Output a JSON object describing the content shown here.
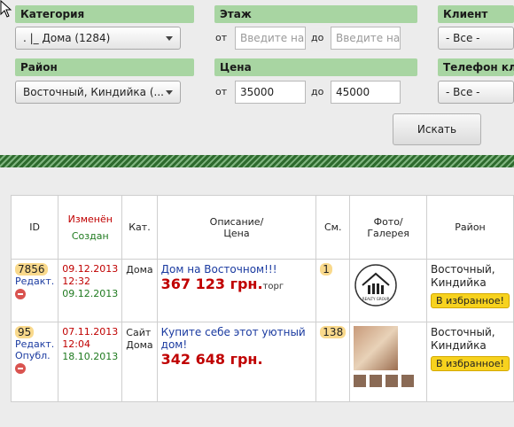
{
  "filters": {
    "category": {
      "label": "Категория",
      "value": ".       |_ Дома (1284)"
    },
    "floor": {
      "label": "Этаж",
      "from_label": "от",
      "from_placeholder": "Введите нач",
      "to_label": "до",
      "to_placeholder": "Введите нач"
    },
    "client": {
      "label": "Клиент",
      "value": "- Все -"
    },
    "district": {
      "label": "Район",
      "value": "Восточный, Киндийка (..."
    },
    "price": {
      "label": "Цена",
      "from_label": "от",
      "from_value": "35000",
      "to_label": "до",
      "to_value": "45000"
    },
    "phone": {
      "label": "Телефон клие",
      "value": "- Все -"
    },
    "search_button": "Искать"
  },
  "table": {
    "headers": {
      "id": "ID",
      "modified": "Изменён",
      "created": "Создан",
      "category": "Кат.",
      "description": "Описание/\nЦена",
      "sm": "См.",
      "photo": "Фото/\nГалерея",
      "district": "Район"
    },
    "rows": [
      {
        "id": "7856",
        "links": [
          "Редакт."
        ],
        "modified": "09.12.2013",
        "modified_time": "12:32",
        "created": "09.12.2013",
        "category": "Дома",
        "title": "Дом на Восточном!!!",
        "price": "367 123 грн.",
        "price_note": "торг",
        "sm": "1",
        "photo_alt": "REALTY GROUP",
        "district": "Восточный, Киндийка",
        "fav": "В избранное!"
      },
      {
        "id": "95",
        "links": [
          "Редакт.",
          "Опубл."
        ],
        "modified": "07.11.2013",
        "modified_time": "12:04",
        "created": "18.10.2013",
        "category": "Сайт Дома",
        "title": "Купите себе этот уютный дом!",
        "price": "342 648 грн.",
        "price_note": "",
        "sm": "138",
        "district": "Восточный, Киндийка",
        "fav": "В избранное!"
      }
    ]
  }
}
